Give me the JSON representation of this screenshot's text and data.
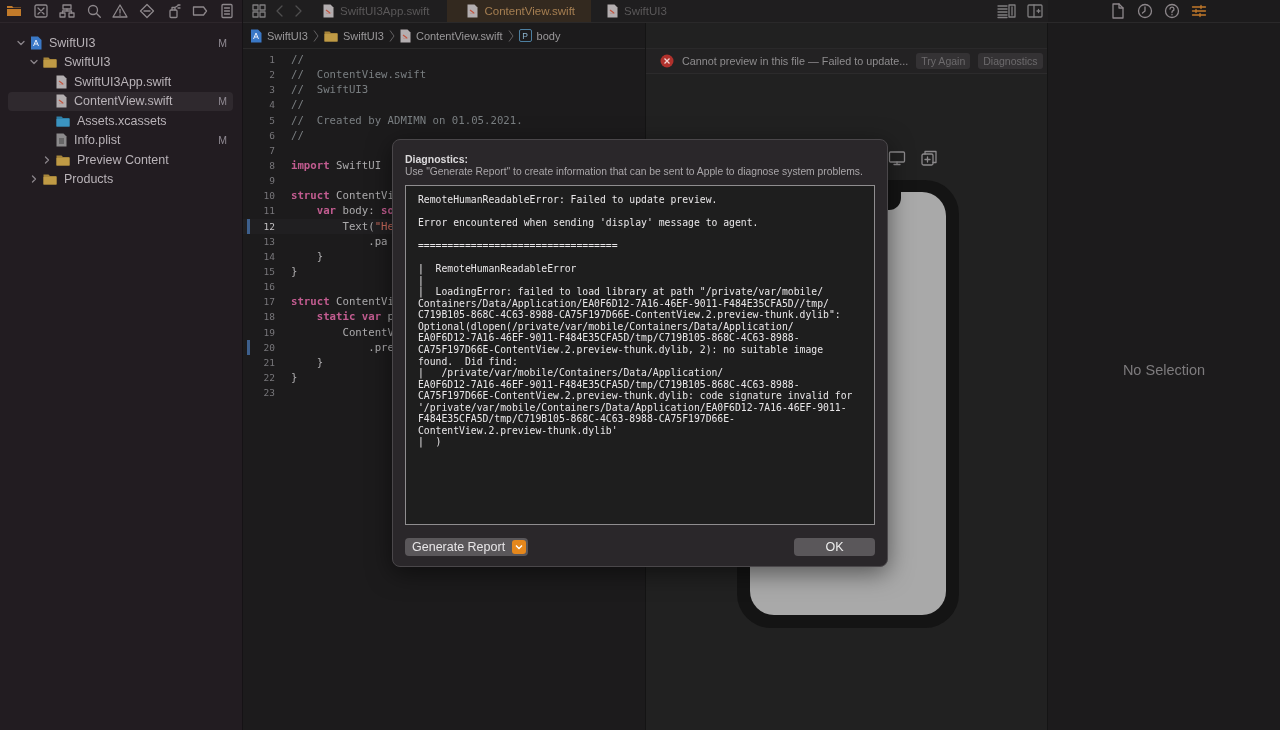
{
  "navigator_tabs": [
    {
      "selected": true
    },
    {
      "selected": false
    },
    {
      "selected": false
    },
    {
      "selected": false
    },
    {
      "selected": false
    },
    {
      "selected": false
    },
    {
      "selected": false
    },
    {
      "selected": false
    },
    {
      "selected": false
    }
  ],
  "navigator": [
    {
      "kind": "project",
      "label": "SwiftUI3",
      "badge": "M",
      "selected": false,
      "expanded": true,
      "children": [
        {
          "kind": "folder",
          "label": "SwiftUI3",
          "selected": false,
          "expanded": true,
          "children": [
            {
              "kind": "swift",
              "label": "SwiftUI3App.swift",
              "selected": false
            },
            {
              "kind": "swift",
              "label": "ContentView.swift",
              "badge": "M",
              "selected": true
            },
            {
              "kind": "assets",
              "label": "Assets.xcassets",
              "selected": false
            },
            {
              "kind": "plist",
              "label": "Info.plist",
              "badge": "M",
              "selected": false
            },
            {
              "kind": "folder",
              "label": "Preview Content",
              "selected": false,
              "expanded": false
            }
          ]
        },
        {
          "kind": "folder",
          "label": "Products",
          "selected": false,
          "expanded": false
        }
      ]
    }
  ],
  "editor_tabs": [
    {
      "label": "SwiftUI3App.swift",
      "selected": false
    },
    {
      "label": "ContentView.swift",
      "selected": true
    },
    {
      "label": "SwiftUI3",
      "selected": false
    }
  ],
  "breadcrumb": [
    {
      "kind": "project",
      "label": "SwiftUI3"
    },
    {
      "kind": "folder",
      "label": "SwiftUI3"
    },
    {
      "kind": "swift",
      "label": "ContentView.swift"
    },
    {
      "kind": "property",
      "icon_letter": "P",
      "label": "body"
    }
  ],
  "code": [
    {
      "number": "1",
      "current": false,
      "changed": false,
      "tokens": [
        {
          "kind": "comment",
          "text": "//"
        }
      ]
    },
    {
      "number": "2",
      "current": false,
      "changed": false,
      "tokens": [
        {
          "kind": "comment",
          "text": "//  ContentView.swift"
        }
      ]
    },
    {
      "number": "3",
      "current": false,
      "changed": false,
      "tokens": [
        {
          "kind": "comment",
          "text": "//  SwiftUI3"
        }
      ]
    },
    {
      "number": "4",
      "current": false,
      "changed": false,
      "tokens": [
        {
          "kind": "comment",
          "text": "//"
        }
      ]
    },
    {
      "number": "5",
      "current": false,
      "changed": false,
      "tokens": [
        {
          "kind": "comment",
          "text": "//  Created by ADMIMN on 01.05.2021."
        }
      ]
    },
    {
      "number": "6",
      "current": false,
      "changed": false,
      "tokens": [
        {
          "kind": "comment",
          "text": "//"
        }
      ]
    },
    {
      "number": "7",
      "current": false,
      "changed": false
    },
    {
      "number": "8",
      "current": false,
      "changed": false,
      "tokens": [
        {
          "kind": "keyword",
          "text": "import"
        },
        {
          "kind": "plain",
          "text": " SwiftUI"
        }
      ]
    },
    {
      "number": "9",
      "current": false,
      "changed": false
    },
    {
      "number": "10",
      "current": false,
      "changed": false,
      "tokens": [
        {
          "kind": "keyword",
          "text": "struct"
        },
        {
          "kind": "plain",
          "text": " ContentVi"
        }
      ]
    },
    {
      "number": "11",
      "current": false,
      "changed": false,
      "tokens": [
        {
          "kind": "keyword",
          "text": "    var"
        },
        {
          "kind": "plain",
          "text": " body: "
        },
        {
          "kind": "keyword",
          "text": "so"
        }
      ]
    },
    {
      "number": "12",
      "current": true,
      "changed": true,
      "tokens": [
        {
          "kind": "plain",
          "text": "        Text("
        },
        {
          "kind": "string",
          "text": "\"He"
        }
      ]
    },
    {
      "number": "13",
      "current": false,
      "changed": false,
      "tokens": [
        {
          "kind": "plain",
          "text": "            .pa"
        }
      ]
    },
    {
      "number": "14",
      "current": false,
      "changed": false,
      "tokens": [
        {
          "kind": "plain",
          "text": "    }"
        }
      ]
    },
    {
      "number": "15",
      "current": false,
      "changed": false,
      "tokens": [
        {
          "kind": "plain",
          "text": "}"
        }
      ]
    },
    {
      "number": "16",
      "current": false,
      "changed": false
    },
    {
      "number": "17",
      "current": false,
      "changed": false,
      "tokens": [
        {
          "kind": "keyword",
          "text": "struct"
        },
        {
          "kind": "plain",
          "text": " ContentVi"
        }
      ]
    },
    {
      "number": "18",
      "current": false,
      "changed": false,
      "tokens": [
        {
          "kind": "keyword",
          "text": "    static var"
        },
        {
          "kind": "plain",
          "text": " p"
        }
      ]
    },
    {
      "number": "19",
      "current": false,
      "changed": false,
      "tokens": [
        {
          "kind": "plain",
          "text": "        ContentV"
        }
      ]
    },
    {
      "number": "20",
      "current": false,
      "changed": true,
      "tokens": [
        {
          "kind": "plain",
          "text": "            .pre"
        }
      ]
    },
    {
      "number": "21",
      "current": false,
      "changed": false,
      "tokens": [
        {
          "kind": "plain",
          "text": "    }"
        }
      ]
    },
    {
      "number": "22",
      "current": false,
      "changed": false,
      "tokens": [
        {
          "kind": "plain",
          "text": "}"
        }
      ]
    },
    {
      "number": "23",
      "current": false,
      "changed": false
    }
  ],
  "preview": {
    "error": "Cannot preview in this file — Failed to update...",
    "buttons": [
      "Try Again",
      "Diagnostics"
    ]
  },
  "inspector_tabs": [
    {
      "selected": false
    },
    {
      "selected": false
    },
    {
      "selected": false
    },
    {
      "selected": true
    }
  ],
  "inspector": {
    "empty_text": "No Selection"
  },
  "dialog": {
    "title": "Diagnostics:",
    "message": "Use \"Generate Report\" to create information that can be sent to Apple to diagnose system problems.",
    "report": [
      [
        "RemoteHumanReadableError: Failed to update preview."
      ],
      [
        "Error encountered when sending 'display' message to agent."
      ],
      [
        "=================================="
      ],
      [
        "|  RemoteHumanReadableError",
        "|",
        "|  LoadingError: failed to load library at path \"/private/var/mobile/",
        "Containers/Data/Application/EA0F6D12-7A16-46EF-9011-F484E35CFA5D//tmp/",
        "C719B105-868C-4C63-8988-CA75F197D66E-ContentView.2.preview-thunk.dylib\":",
        "Optional(dlopen(/private/var/mobile/Containers/Data/Application/",
        "EA0F6D12-7A16-46EF-9011-F484E35CFA5D/tmp/C719B105-868C-4C63-8988-",
        "CA75F197D66E-ContentView.2.preview-thunk.dylib, 2): no suitable image",
        "found.  Did find:",
        "|   /private/var/mobile/Containers/Data/Application/",
        "EA0F6D12-7A16-46EF-9011-F484E35CFA5D/tmp/C719B105-868C-4C63-8988-",
        "CA75F197D66E-ContentView.2.preview-thunk.dylib: code signature invalid for",
        "'/private/var/mobile/Containers/Data/Application/EA0F6D12-7A16-46EF-9011-",
        "F484E35CFA5D/tmp/C719B105-868C-4C63-8988-CA75F197D66E-",
        "ContentView.2.preview-thunk.dylib'",
        "|  )"
      ]
    ],
    "menu_button": "Generate Report",
    "ok_button": "OK"
  }
}
